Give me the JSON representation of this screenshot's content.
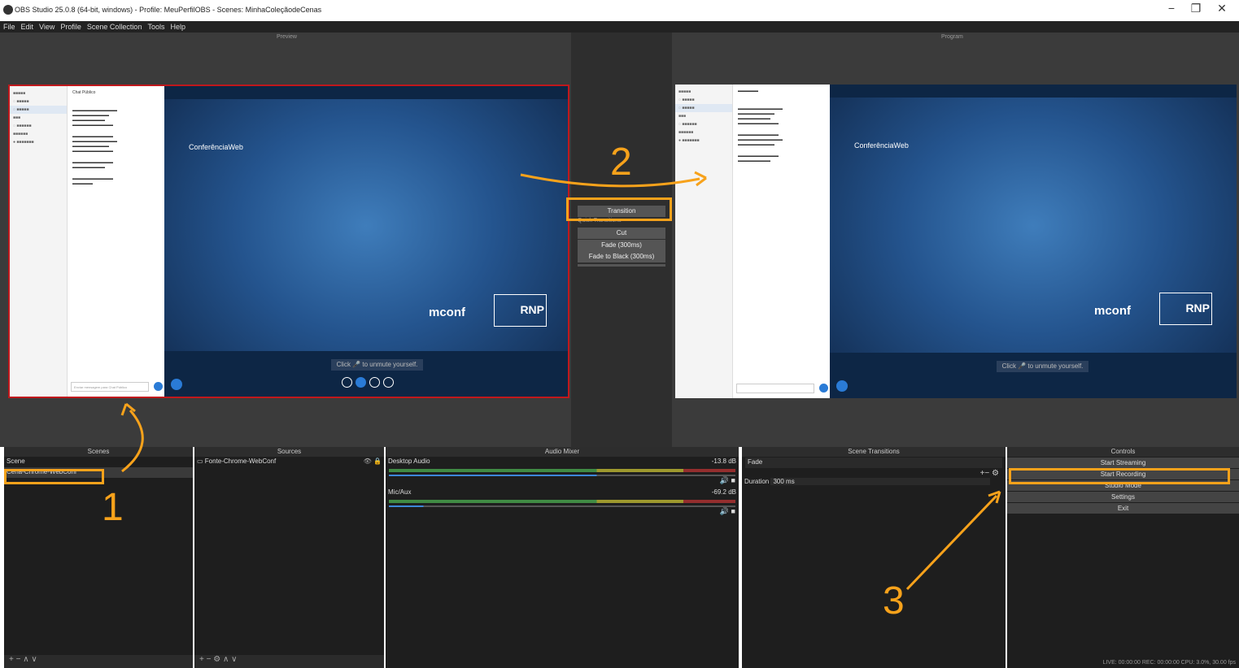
{
  "window": {
    "title": "OBS Studio 25.0.8 (64-bit, windows) - Profile: MeuPerfilOBS - Scenes: MinhaColeçãodeCenas",
    "minimize": "−",
    "maximize": "❐",
    "close": "✕"
  },
  "menu": [
    "File",
    "Edit",
    "View",
    "Profile",
    "Scene Collection",
    "Tools",
    "Help"
  ],
  "preview_label": "Preview",
  "program_label": "Program",
  "conference": {
    "brand": "ConferênciaWeb",
    "mconf": "mconf",
    "rnp": "RNP",
    "unmute_hint": "Click 🎤 to unmute yourself.",
    "chat_placeholder": "Enviar mensagem para Chat Público",
    "chat_title": "Chat Público"
  },
  "center": {
    "transition_button": "Transition",
    "quick_transitions_label": "Quick Transitions",
    "quick_transitions": [
      "Cut",
      "Fade (300ms)",
      "Fade to Black (300ms)"
    ]
  },
  "docks": {
    "scenes": {
      "title": "Scenes",
      "items": [
        "Scene",
        "Cena-Chrome-WebConf"
      ],
      "footer": "+ −  ∧ ∨"
    },
    "sources": {
      "title": "Sources",
      "items": [
        "Fonte-Chrome-WebConf"
      ],
      "footer": "+ − ⚙  ∧ ∨"
    },
    "audio_mixer": {
      "title": "Audio Mixer",
      "channels": [
        {
          "name": "Desktop Audio",
          "db": "-13.8 dB",
          "level": 0.6
        },
        {
          "name": "Mic/Aux",
          "db": "-69.2 dB",
          "level": 0.1
        }
      ]
    },
    "scene_transitions": {
      "title": "Scene Transitions",
      "selected": "Fade",
      "duration_label": "Duration",
      "duration_value": "300 ms"
    },
    "controls": {
      "title": "Controls",
      "buttons": [
        "Start Streaming",
        "Start Recording",
        "Studio Mode",
        "Settings",
        "Exit"
      ]
    }
  },
  "status": "LIVE: 00:00:00  REC: 00:00:00   CPU: 3.0%, 30.00 fps",
  "annotations": [
    "1",
    "2",
    "3"
  ],
  "colors": {
    "annotation": "#f7a21b",
    "preview_border": "#c0181c"
  }
}
